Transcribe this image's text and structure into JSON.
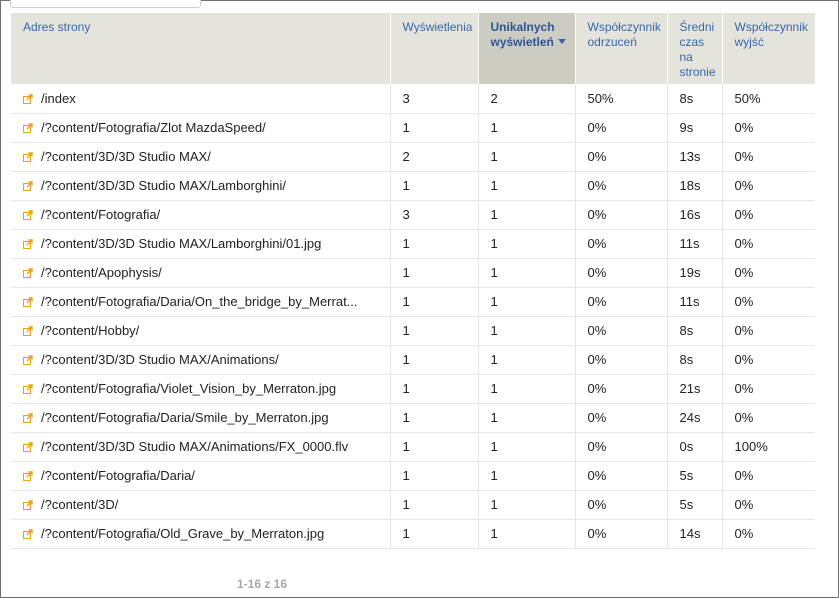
{
  "table": {
    "headers": {
      "page": "Adres strony",
      "views": "Wyświetlenia",
      "unique": "Unikalnych wyświetleń",
      "bounce": "Współczynnik odrzuceń",
      "avg_time": "Średni czas na stronie",
      "exit": "Współczynnik wyjść"
    },
    "sorted_column": "unique",
    "sort_direction": "descending",
    "rows": [
      {
        "page": "/index",
        "views": "3",
        "unique": "2",
        "bounce": "50%",
        "avg_time": "8s",
        "exit": "50%"
      },
      {
        "page": "/?content/Fotografia/Zlot MazdaSpeed/",
        "views": "1",
        "unique": "1",
        "bounce": "0%",
        "avg_time": "9s",
        "exit": "0%"
      },
      {
        "page": "/?content/3D/3D Studio MAX/",
        "views": "2",
        "unique": "1",
        "bounce": "0%",
        "avg_time": "13s",
        "exit": "0%"
      },
      {
        "page": "/?content/3D/3D Studio MAX/Lamborghini/",
        "views": "1",
        "unique": "1",
        "bounce": "0%",
        "avg_time": "18s",
        "exit": "0%"
      },
      {
        "page": "/?content/Fotografia/",
        "views": "3",
        "unique": "1",
        "bounce": "0%",
        "avg_time": "16s",
        "exit": "0%"
      },
      {
        "page": "/?content/3D/3D Studio MAX/Lamborghini/01.jpg",
        "views": "1",
        "unique": "1",
        "bounce": "0%",
        "avg_time": "11s",
        "exit": "0%"
      },
      {
        "page": "/?content/Apophysis/",
        "views": "1",
        "unique": "1",
        "bounce": "0%",
        "avg_time": "19s",
        "exit": "0%"
      },
      {
        "page": "/?content/Fotografia/Daria/On_the_bridge_by_Merrat...",
        "views": "1",
        "unique": "1",
        "bounce": "0%",
        "avg_time": "11s",
        "exit": "0%"
      },
      {
        "page": "/?content/Hobby/",
        "views": "1",
        "unique": "1",
        "bounce": "0%",
        "avg_time": "8s",
        "exit": "0%"
      },
      {
        "page": "/?content/3D/3D Studio MAX/Animations/",
        "views": "1",
        "unique": "1",
        "bounce": "0%",
        "avg_time": "8s",
        "exit": "0%"
      },
      {
        "page": "/?content/Fotografia/Violet_Vision_by_Merraton.jpg",
        "views": "1",
        "unique": "1",
        "bounce": "0%",
        "avg_time": "21s",
        "exit": "0%"
      },
      {
        "page": "/?content/Fotografia/Daria/Smile_by_Merraton.jpg",
        "views": "1",
        "unique": "1",
        "bounce": "0%",
        "avg_time": "24s",
        "exit": "0%"
      },
      {
        "page": "/?content/3D/3D Studio MAX/Animations/FX_0000.flv",
        "views": "1",
        "unique": "1",
        "bounce": "0%",
        "avg_time": "0s",
        "exit": "100%"
      },
      {
        "page": "/?content/Fotografia/Daria/",
        "views": "1",
        "unique": "1",
        "bounce": "0%",
        "avg_time": "5s",
        "exit": "0%"
      },
      {
        "page": "/?content/3D/",
        "views": "1",
        "unique": "1",
        "bounce": "0%",
        "avg_time": "5s",
        "exit": "0%"
      },
      {
        "page": "/?content/Fotografia/Old_Grave_by_Merraton.jpg",
        "views": "1",
        "unique": "1",
        "bounce": "0%",
        "avg_time": "14s",
        "exit": "0%"
      }
    ]
  },
  "pagination": {
    "label": "1-16 z 16"
  },
  "icons": {
    "row_link": "external-link-icon",
    "sort": "sort-descending-icon"
  },
  "colors": {
    "header_bg": "#e4e4dd",
    "sorted_header_bg": "#cdccc2",
    "header_text": "#3a66a8",
    "link_icon": "#e8a21a"
  }
}
